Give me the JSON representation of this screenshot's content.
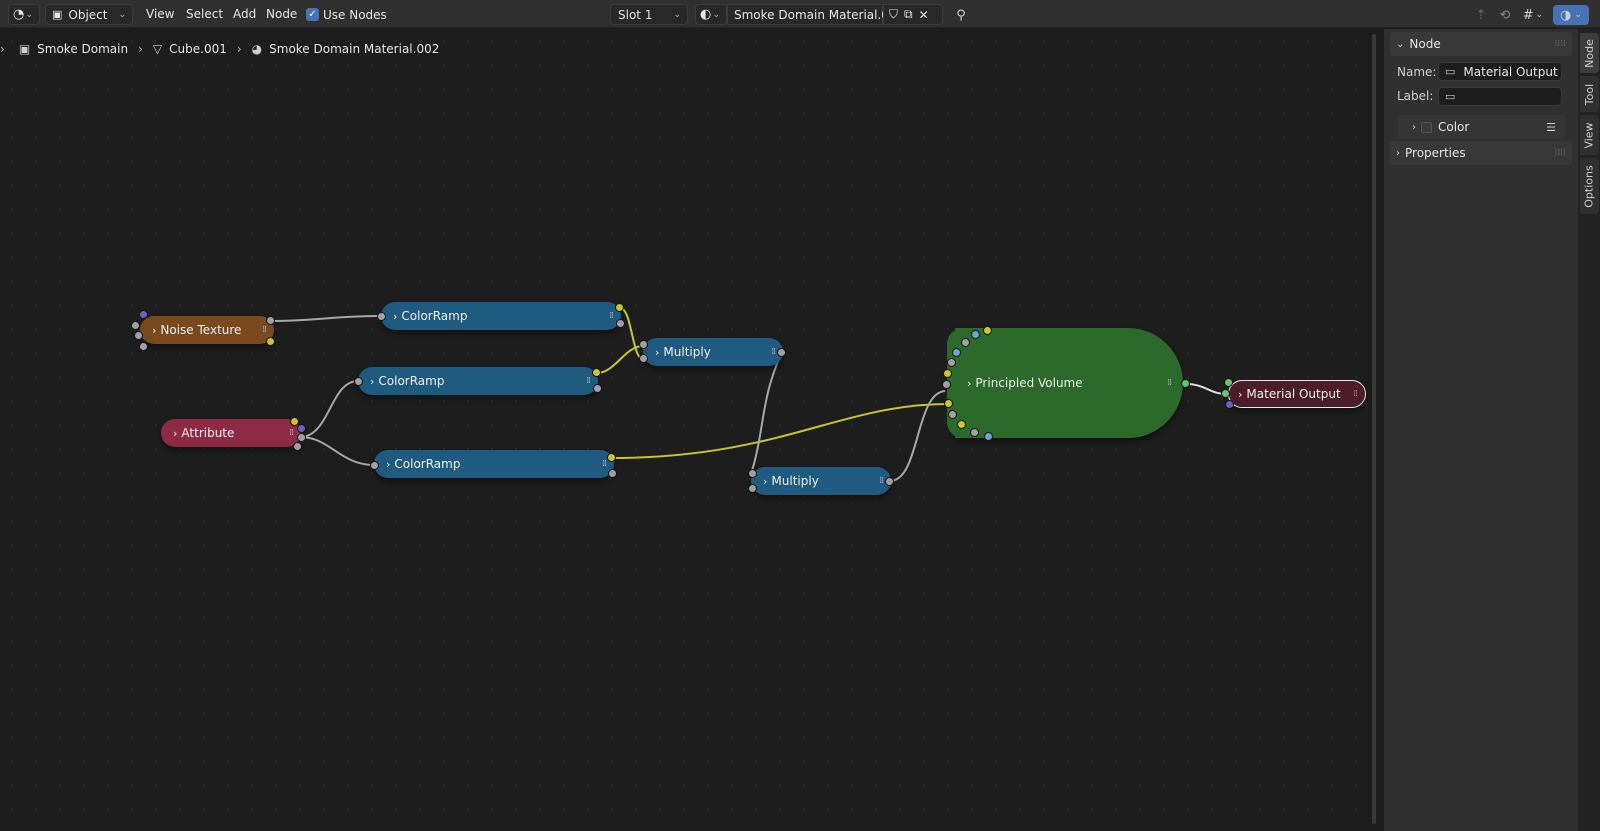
{
  "header": {
    "editor_type_icon": "node-editor-icon",
    "mode_label": "Object",
    "menus": [
      "View",
      "Select",
      "Add",
      "Node"
    ],
    "use_nodes_label": "Use Nodes",
    "slot_label": "Slot 1",
    "material_name": "Smoke Domain Material.002"
  },
  "breadcrumb": {
    "items": [
      {
        "label": "Smoke Domain",
        "icon": "object-icon"
      },
      {
        "label": "Cube.001",
        "icon": "mesh-icon"
      },
      {
        "label": "Smoke Domain Material.002",
        "icon": "material-icon"
      }
    ]
  },
  "nodes": {
    "noise": "Noise Texture",
    "attribute": "Attribute",
    "ramp1": "ColorRamp",
    "ramp2": "ColorRamp",
    "ramp3": "ColorRamp",
    "mult1": "Multiply",
    "mult2": "Multiply",
    "principled": "Principled Volume",
    "output": "Material Output"
  },
  "sidebar": {
    "panel_title": "Node",
    "name_label": "Name:",
    "name_value": "Material Output",
    "label_label": "Label:",
    "label_value": "",
    "color_label": "Color",
    "properties_title": "Properties",
    "tabs": [
      "Node",
      "Tool",
      "View",
      "Options"
    ]
  },
  "colors": {
    "header_bg": "#303030",
    "editor_bg": "#1d1d1d",
    "noise_node": "#7a4a1e",
    "attribute_node": "#8e2a45",
    "ramp_node": "#1f5a80",
    "principled_node": "#2c6a2c",
    "output_node": "#4c1d28",
    "link_gray": "#a8a8a8",
    "link_yellow": "#c7c729"
  }
}
